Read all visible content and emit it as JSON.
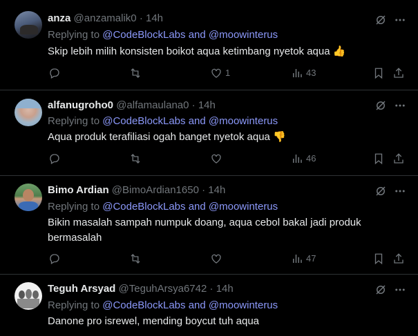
{
  "tweets": [
    {
      "name": "anza",
      "handle": "@anzamalik0",
      "dot": "·",
      "time": "14h",
      "reply_prefix": "Replying to",
      "mention1": "@CodeBlockLabs",
      "and": "and",
      "mention2": "@moowinterus",
      "text": "Skip lebih milih konsisten boikot aqua ketimbang nyetok aqua 👍",
      "likes": "1",
      "views": "43"
    },
    {
      "name": "alfanugroho0",
      "handle": "@alfamaulana0",
      "dot": "·",
      "time": "14h",
      "reply_prefix": "Replying to",
      "mention1": "@CodeBlockLabs",
      "and": "and",
      "mention2": "@moowinterus",
      "text": "Aqua produk terafiliasi ogah banget nyetok aqua 👎",
      "likes": "",
      "views": "46"
    },
    {
      "name": "Bimo Ardian",
      "handle": "@BimoArdian1650",
      "dot": "·",
      "time": "14h",
      "reply_prefix": "Replying to",
      "mention1": "@CodeBlockLabs",
      "and": "and",
      "mention2": "@moowinterus",
      "text": "Bikin masalah sampah numpuk doang, aqua cebol bakal jadi produk bermasalah",
      "likes": "",
      "views": "47"
    },
    {
      "name": "Teguh Arsyad",
      "handle": "@TeguhArsya6742",
      "dot": "·",
      "time": "14h",
      "reply_prefix": "Replying to",
      "mention1": "@CodeBlockLabs",
      "and": "and",
      "mention2": "@moowinterus",
      "text": "Danone pro isrewel, mending boycut tuh aqua",
      "likes": "",
      "views": ""
    }
  ],
  "icons": {
    "reply": "reply-icon",
    "retweet": "retweet-icon",
    "like": "heart-icon",
    "views": "views-icon",
    "bookmark": "bookmark-icon",
    "share": "share-icon",
    "grok": "grok-icon",
    "more": "more-icon"
  },
  "colors": {
    "background": "#000000",
    "text": "#e7e9ea",
    "muted": "#71767b",
    "mention": "#8b98f9",
    "divider": "#2f3336"
  }
}
